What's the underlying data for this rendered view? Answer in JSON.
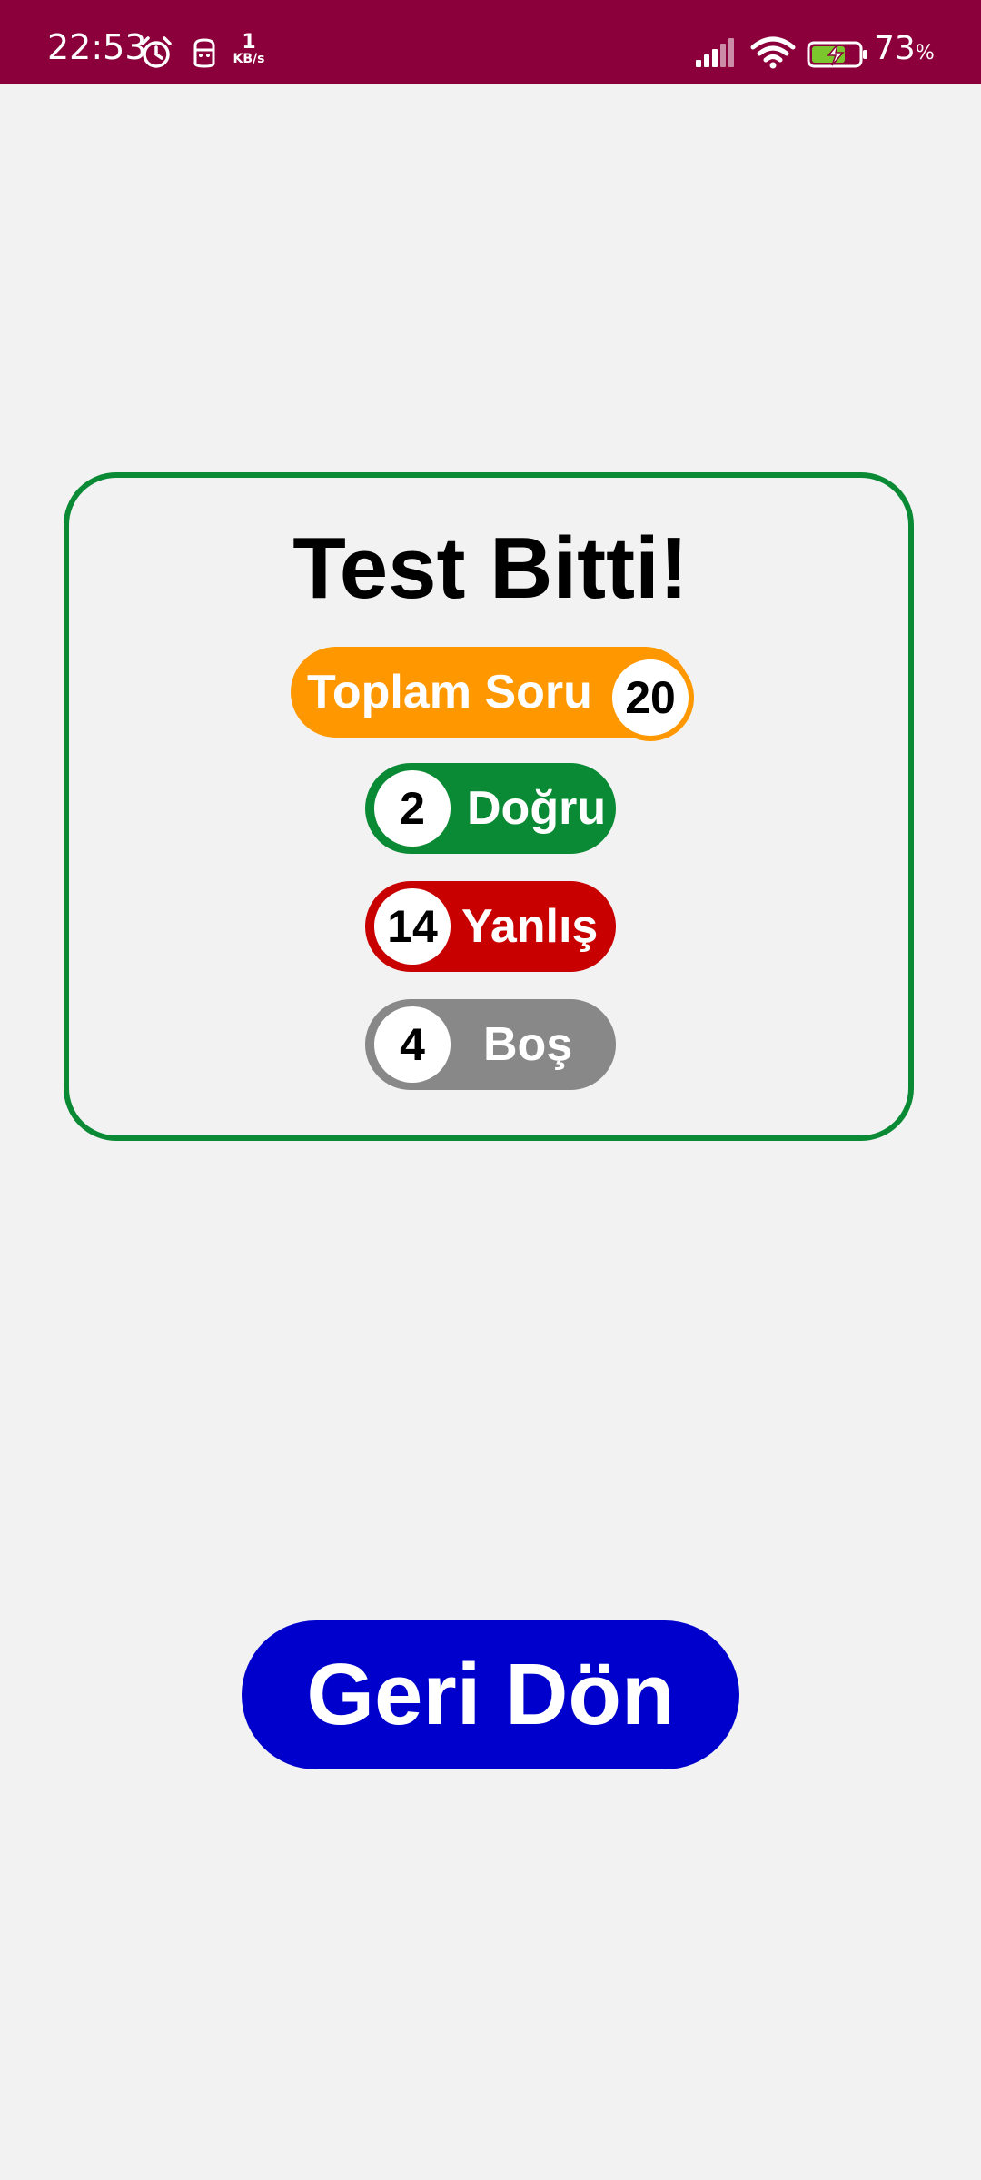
{
  "status_bar": {
    "time": "22:53",
    "net_speed_value": "1",
    "net_speed_unit": "KB/s",
    "battery_level": "73",
    "battery_unit": "%",
    "background_color": "#8b003b",
    "icons": [
      "alarm-icon",
      "app-notification-icon",
      "signal-icon",
      "wifi-icon",
      "battery-charging-icon"
    ]
  },
  "result_card": {
    "title": "Test Bitti!",
    "border_color": "#0a8a34",
    "total": {
      "label": "Toplam Soru",
      "value": "20",
      "color": "#ff9800"
    },
    "correct": {
      "label": "Doğru",
      "value": "2",
      "color": "#0a8a34"
    },
    "wrong": {
      "label": "Yanlış",
      "value": "14",
      "color": "#c80000"
    },
    "empty": {
      "label": "Boş",
      "value": "4",
      "color": "#888888"
    }
  },
  "back_button": {
    "label": "Geri Dön",
    "color": "#0000cc"
  },
  "page": {
    "background_color": "#f2f2f2"
  }
}
